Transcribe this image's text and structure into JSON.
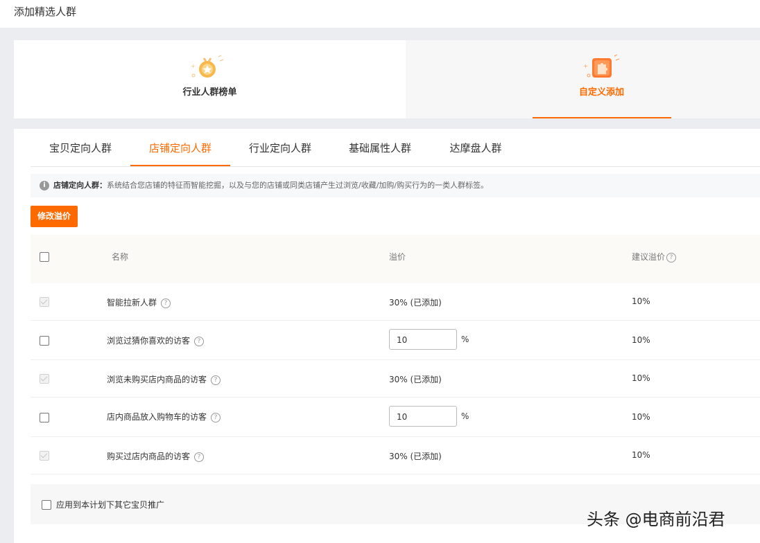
{
  "page_title": "添加精选人群",
  "cards": [
    {
      "label": "行业人群榜单",
      "icon": "medal-star-icon",
      "active": false
    },
    {
      "label": "自定义添加",
      "icon": "puzzle-piece-icon",
      "active": true
    }
  ],
  "tabs": [
    {
      "label": "宝贝定向人群",
      "active": false
    },
    {
      "label": "店铺定向人群",
      "active": true
    },
    {
      "label": "行业定向人群",
      "active": false
    },
    {
      "label": "基础属性人群",
      "active": false
    },
    {
      "label": "达摩盘人群",
      "active": false
    }
  ],
  "tip": {
    "title": "店铺定向人群：",
    "text": "系统结合您店铺的特征而智能挖掘，以及与您的店铺或同类店铺产生过浏览/收藏/加购/购买行为的一类人群标签。"
  },
  "modify_button": "修改溢价",
  "table": {
    "headers": {
      "name": "名称",
      "premium": "溢价",
      "suggested": "建议溢价"
    },
    "rows": [
      {
        "name": "智能拉新人群",
        "premium": "30% (已添加)",
        "suggested": "10%",
        "added": true
      },
      {
        "name": "浏览过猜你喜欢的访客",
        "input_value": "10",
        "unit": "%",
        "suggested": "10%",
        "added": false
      },
      {
        "name": "浏览未购买店内商品的访客",
        "premium": "30% (已添加)",
        "suggested": "10%",
        "added": true
      },
      {
        "name": "店内商品放入购物车的访客",
        "input_value": "10",
        "unit": "%",
        "suggested": "10%",
        "added": false
      },
      {
        "name": "购买过店内商品的访客",
        "premium": "30% (已添加)",
        "suggested": "10%",
        "added": true
      }
    ]
  },
  "footer": {
    "apply_label": "应用到本计划下其它宝贝推广"
  },
  "watermark": "头条 @电商前沿君",
  "colors": {
    "accent": "#ff6a00",
    "background": "#ebedf0"
  }
}
